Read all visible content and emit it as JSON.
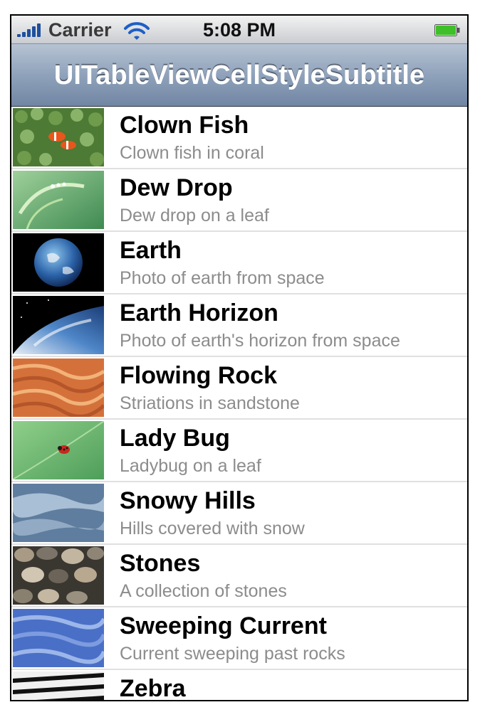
{
  "status_bar": {
    "carrier": "Carrier",
    "time": "5:08 PM",
    "signal_icon": "signal-bars-icon",
    "wifi_icon": "wifi-icon",
    "battery_icon": "battery-icon",
    "battery_color": "#3fbf2a"
  },
  "nav_bar": {
    "title": "UITableViewCellStyleSubtitle",
    "color": "#8fa2bb"
  },
  "table": {
    "rows": [
      {
        "title": "Clown Fish",
        "subtitle": "Clown fish in coral"
      },
      {
        "title": "Dew Drop",
        "subtitle": "Dew drop on a leaf"
      },
      {
        "title": "Earth",
        "subtitle": "Photo of earth from space"
      },
      {
        "title": "Earth Horizon",
        "subtitle": "Photo of earth's horizon from space"
      },
      {
        "title": "Flowing Rock",
        "subtitle": "Striations in sandstone"
      },
      {
        "title": "Lady Bug",
        "subtitle": "Ladybug on a leaf"
      },
      {
        "title": "Snowy Hills",
        "subtitle": "Hills covered with snow"
      },
      {
        "title": "Stones",
        "subtitle": "A collection of stones"
      },
      {
        "title": "Sweeping Current",
        "subtitle": "Current sweeping past rocks"
      },
      {
        "title": "Zebra",
        "subtitle": ""
      }
    ]
  }
}
